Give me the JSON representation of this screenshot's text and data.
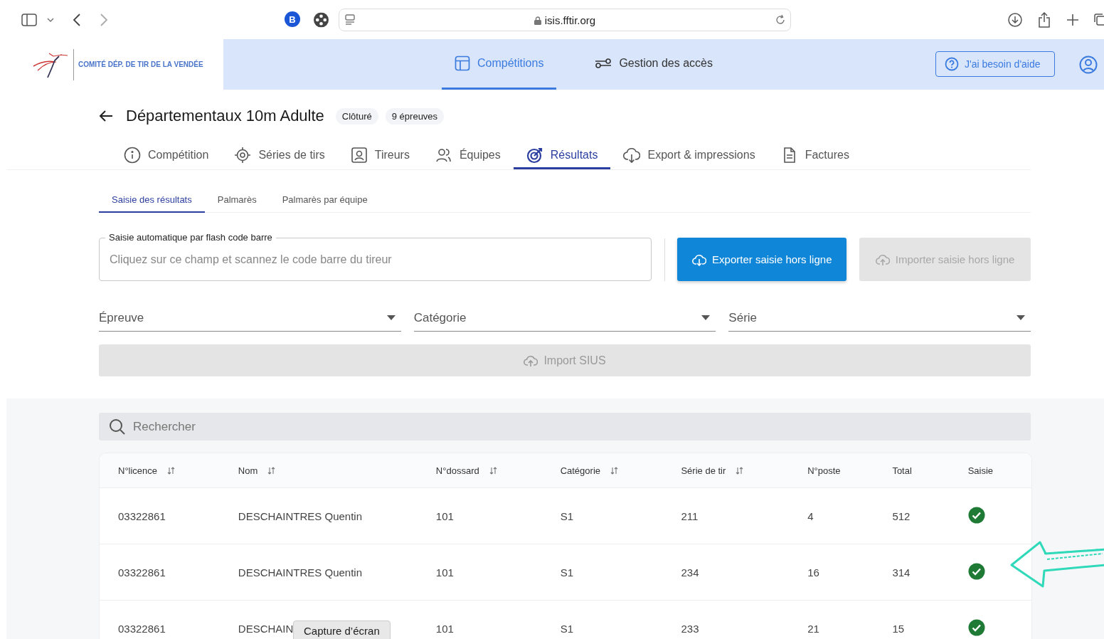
{
  "browser": {
    "url": "isis.fftir.org",
    "extension_badge": "B"
  },
  "header": {
    "org_name": "COMITÉ DÉP. DE TIR DE LA VENDÉE",
    "nav": [
      {
        "label": "Compétitions",
        "selected": true
      },
      {
        "label": "Gestion des accès",
        "selected": false
      }
    ],
    "help_button": "J'ai besoin d'aide"
  },
  "competition": {
    "title": "Départementaux 10m Adulte",
    "badges": [
      "Clôturé",
      "9 épreuves"
    ]
  },
  "tabs": [
    {
      "label": "Compétition",
      "selected": false
    },
    {
      "label": "Séries de tirs",
      "selected": false
    },
    {
      "label": "Tireurs",
      "selected": false
    },
    {
      "label": "Équipes",
      "selected": false
    },
    {
      "label": "Résultats",
      "selected": true
    },
    {
      "label": "Export & impressions",
      "selected": false
    },
    {
      "label": "Factures",
      "selected": false
    }
  ],
  "subtabs": [
    {
      "label": "Saisie des résultats",
      "selected": true
    },
    {
      "label": "Palmarès",
      "selected": false
    },
    {
      "label": "Palmarès par équipe",
      "selected": false
    }
  ],
  "barcode_field": {
    "label": "Saisie automatique par flash code barre",
    "placeholder": "Cliquez sur ce champ et scannez le code barre du tireur"
  },
  "buttons": [
    {
      "label": "Exporter saisie hors ligne",
      "disabled": false
    },
    {
      "label": "Importer saisie hors ligne",
      "disabled": true
    }
  ],
  "filters": [
    {
      "label": "Épreuve"
    },
    {
      "label": "Catégorie"
    },
    {
      "label": "Série"
    }
  ],
  "import_sius": {
    "label": "Import SIUS",
    "disabled": true
  },
  "search": {
    "placeholder": "Rechercher"
  },
  "table": {
    "columns": [
      {
        "label": "N°licence",
        "sortable": true
      },
      {
        "label": "Nom",
        "sortable": true
      },
      {
        "label": "N°dossard",
        "sortable": true
      },
      {
        "label": "Catégorie",
        "sortable": true
      },
      {
        "label": "Série de tir",
        "sortable": true
      },
      {
        "label": "N°poste",
        "sortable": false
      },
      {
        "label": "Total",
        "sortable": false
      },
      {
        "label": "Saisie",
        "sortable": false
      }
    ],
    "rows": [
      {
        "cells": [
          "03322861",
          "DESCHAINTRES Quentin",
          "101",
          "S1",
          "211",
          "4",
          "512"
        ],
        "saisie_done": true
      },
      {
        "cells": [
          "03322861",
          "DESCHAINTRES Quentin",
          "101",
          "S1",
          "234",
          "16",
          "314"
        ],
        "saisie_done": true
      },
      {
        "cells": [
          "03322861",
          "DESCHAIN",
          "101",
          "S1",
          "233",
          "21",
          "15"
        ],
        "saisie_done": true
      }
    ]
  },
  "tooltip": "Capture d’écran"
}
